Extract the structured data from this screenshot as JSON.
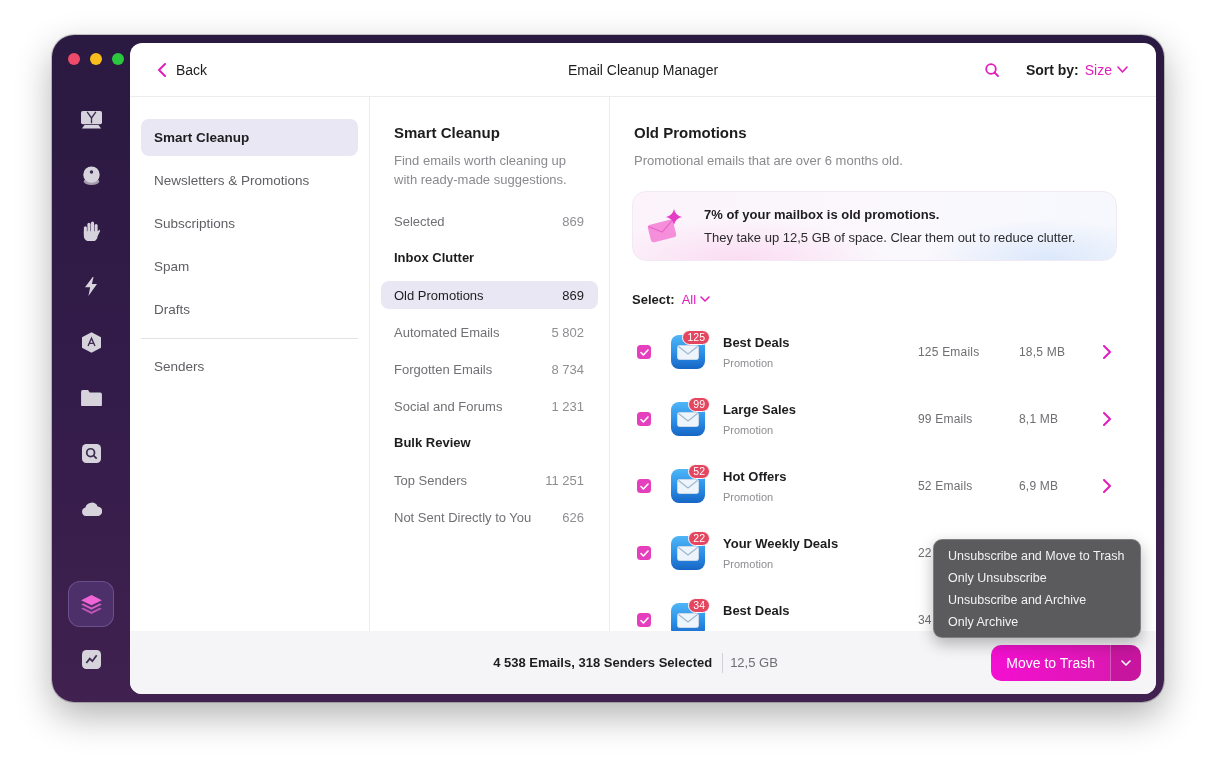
{
  "app_sidebar": {
    "top": [
      {
        "selected": false
      },
      {
        "selected": false
      },
      {
        "selected": false
      },
      {
        "selected": false
      },
      {
        "selected": false
      },
      {
        "selected": false
      },
      {
        "selected": false
      },
      {
        "selected": false
      }
    ],
    "bottom": [
      {
        "selected": true
      },
      {
        "selected": false
      }
    ]
  },
  "toolbar": {
    "back": "Back",
    "title": "Email Cleanup Manager",
    "sort_label": "Sort by:",
    "sort_value": "Size"
  },
  "categories": [
    {
      "items": [
        {
          "label": "Smart Cleanup",
          "selected": true
        },
        {
          "label": "Newsletters & Promotions",
          "selected": false
        },
        {
          "label": "Subscriptions",
          "selected": false
        },
        {
          "label": "Spam",
          "selected": false
        },
        {
          "label": "Drafts",
          "selected": false
        }
      ]
    },
    {
      "items": [
        {
          "label": "Senders",
          "selected": false
        }
      ]
    }
  ],
  "suggestions": {
    "title": "Smart Cleanup",
    "description": "Find emails worth cleaning up with ready-made suggestions.",
    "rows": [
      {
        "kind": "item",
        "label": "Selected",
        "count": "869",
        "selected": false
      },
      {
        "kind": "header",
        "label": "Inbox Clutter"
      },
      {
        "kind": "item",
        "label": "Old Promotions",
        "count": "869",
        "selected": true
      },
      {
        "kind": "item",
        "label": "Automated Emails",
        "count": "5 802",
        "selected": false
      },
      {
        "kind": "item",
        "label": "Forgotten Emails",
        "count": "8 734",
        "selected": false
      },
      {
        "kind": "item",
        "label": "Social and Forums",
        "count": "1 231",
        "selected": false
      },
      {
        "kind": "header",
        "label": "Bulk Review"
      },
      {
        "kind": "item",
        "label": "Top Senders",
        "count": "11 251",
        "selected": false
      },
      {
        "kind": "item",
        "label": "Not Sent Directly to You",
        "count": "626",
        "selected": false
      }
    ]
  },
  "detail": {
    "title": "Old Promotions",
    "description": "Promotional emails that are over 6 months old.",
    "banner": {
      "headline": "7% of your mailbox is old promotions.",
      "text": "They take up 12,5 GB of space. Clear them out to reduce clutter."
    },
    "select": {
      "label": "Select:",
      "value": "All"
    },
    "senders": [
      {
        "checked": true,
        "badge": "125",
        "name": "Best Deals",
        "category": "Promotion",
        "emails": "125 Emails",
        "size": "18,5 MB"
      },
      {
        "checked": true,
        "badge": "99",
        "name": "Large Sales",
        "category": "Promotion",
        "emails": "99 Emails",
        "size": "8,1 MB"
      },
      {
        "checked": true,
        "badge": "52",
        "name": "Hot Offers",
        "category": "Promotion",
        "emails": "52 Emails",
        "size": "6,9 MB"
      },
      {
        "checked": true,
        "badge": "22",
        "name": "Your Weekly Deals",
        "category": "Promotion",
        "emails": "22"
      },
      {
        "checked": true,
        "badge": "34",
        "name": "Best Deals",
        "emails": "34"
      }
    ]
  },
  "footer": {
    "summary": "4 538 Emails, 318 Senders Selected",
    "size": "12,5 GB",
    "action": "Move to Trash",
    "menu_open": true,
    "menu": [
      "Unsubscribe and Move to Trash",
      "Only Unsubscribe",
      "Unsubscribe and Archive",
      "Only Archive"
    ]
  }
}
